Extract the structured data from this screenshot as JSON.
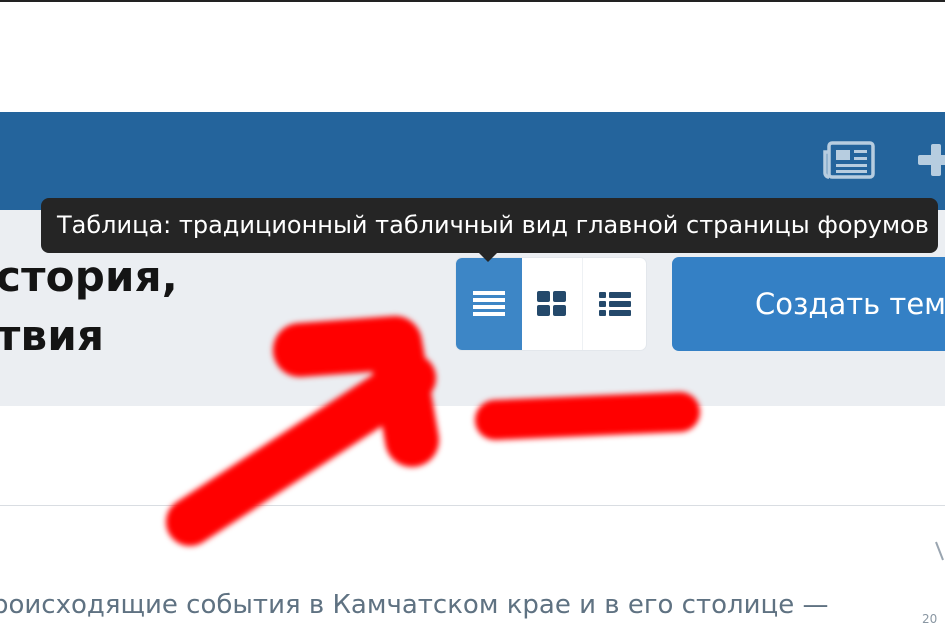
{
  "tooltip": {
    "text": "Таблица: традиционный табличный вид главной страницы форумов"
  },
  "header": {
    "title_line_1": "стория,",
    "title_line_2": "твия"
  },
  "view_switch": {
    "active": "table",
    "items": [
      {
        "id": "table",
        "icon": "table-view-icon"
      },
      {
        "id": "grid",
        "icon": "grid-view-icon"
      },
      {
        "id": "list",
        "icon": "list-view-icon"
      }
    ]
  },
  "actions": {
    "create_topic_label": "Создать тему"
  },
  "navbar": {
    "icons": [
      "newspaper-icon",
      "plus-icon"
    ]
  },
  "forum": {
    "description": "роисходящие события в Камчатском крае и в его столице —",
    "edge_text": "20"
  },
  "colors": {
    "navbar": "#24649c",
    "header_band": "#ebeef2",
    "active_view": "#3d86c6",
    "create_button": "#3480c5",
    "tooltip": "#252525",
    "annotation": "#ff0000"
  }
}
